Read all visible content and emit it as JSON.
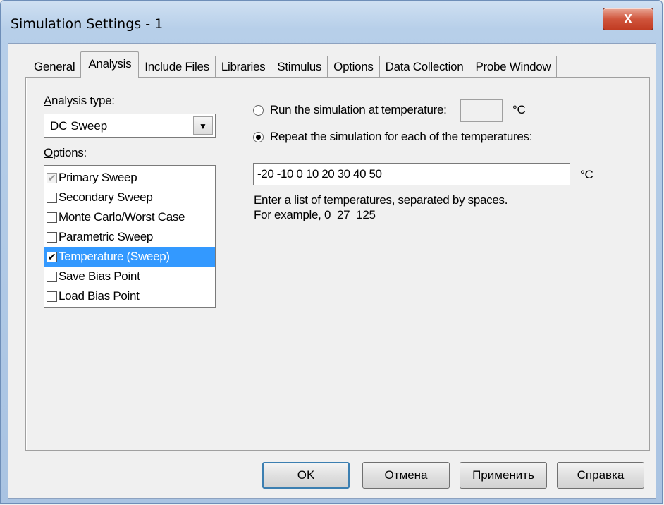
{
  "window": {
    "title": "Simulation Settings - 1",
    "close_glyph": "X"
  },
  "tabs": [
    {
      "label": "General"
    },
    {
      "label": "Analysis"
    },
    {
      "label": "Include Files"
    },
    {
      "label": "Libraries"
    },
    {
      "label": "Stimulus"
    },
    {
      "label": "Options"
    },
    {
      "label": "Data Collection"
    },
    {
      "label": "Probe Window"
    }
  ],
  "active_tab": "Analysis",
  "analysis_type": {
    "label_prefix": "A",
    "label_rest": "nalysis type:",
    "value": "DC Sweep",
    "arrow_icon": "chevron-down-icon"
  },
  "options": {
    "label_prefix": "O",
    "label_rest": "ptions:",
    "items": [
      {
        "label": "Primary Sweep",
        "checked": true,
        "disabled": true,
        "selected": false
      },
      {
        "label": "Secondary Sweep",
        "checked": false,
        "disabled": false,
        "selected": false
      },
      {
        "label": "Monte Carlo/Worst Case",
        "checked": false,
        "disabled": false,
        "selected": false
      },
      {
        "label": "Parametric Sweep",
        "checked": false,
        "disabled": false,
        "selected": false
      },
      {
        "label": "Temperature (Sweep)",
        "checked": true,
        "disabled": false,
        "selected": true
      },
      {
        "label": "Save Bias Point",
        "checked": false,
        "disabled": false,
        "selected": false
      },
      {
        "label": "Load Bias Point",
        "checked": false,
        "disabled": false,
        "selected": false
      }
    ]
  },
  "temperature": {
    "radio_single_label": "Run the simulation at temperature:",
    "single_value": "",
    "unit": "°C",
    "radio_multi_label": "Repeat the simulation for each of the temperatures:",
    "multi_value": "-20 -10 0 10 20 30 40 50",
    "hint_line1": "Enter a list of temperatures, separated by spaces.",
    "hint_line2": "For example, 0  27  125"
  },
  "buttons": {
    "ok": "OK",
    "cancel": "Отмена",
    "apply_pre": "При",
    "apply_u": "м",
    "apply_post": "енить",
    "help": "Справка"
  },
  "colors": {
    "selection": "#3399ff",
    "close": "#c13b22"
  }
}
